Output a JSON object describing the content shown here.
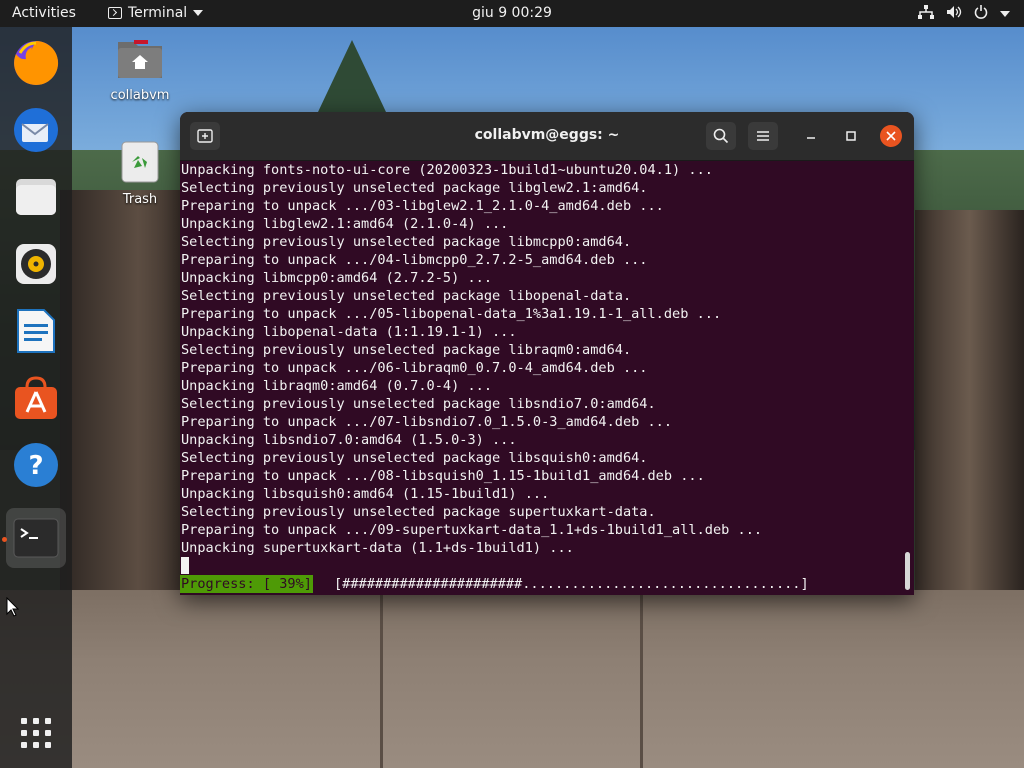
{
  "topbar": {
    "activities": "Activities",
    "app_name": "Terminal",
    "clock": "giu 9  00:29"
  },
  "dock": {
    "items": [
      "firefox",
      "thunderbird",
      "files",
      "rhythmbox",
      "writer",
      "software",
      "help",
      "terminal"
    ]
  },
  "desktop": {
    "icons": [
      {
        "label": "collabvm",
        "icon": "home-folder-icon"
      },
      {
        "label": "Trash",
        "icon": "trash-icon"
      }
    ]
  },
  "window": {
    "title": "collabvm@eggs: ~",
    "terminal_lines": [
      "Unpacking fonts-noto-ui-core (20200323-1build1~ubuntu20.04.1) ...",
      "Selecting previously unselected package libglew2.1:amd64.",
      "Preparing to unpack .../03-libglew2.1_2.1.0-4_amd64.deb ...",
      "Unpacking libglew2.1:amd64 (2.1.0-4) ...",
      "Selecting previously unselected package libmcpp0:amd64.",
      "Preparing to unpack .../04-libmcpp0_2.7.2-5_amd64.deb ...",
      "Unpacking libmcpp0:amd64 (2.7.2-5) ...",
      "Selecting previously unselected package libopenal-data.",
      "Preparing to unpack .../05-libopenal-data_1%3a1.19.1-1_all.deb ...",
      "Unpacking libopenal-data (1:1.19.1-1) ...",
      "Selecting previously unselected package libraqm0:amd64.",
      "Preparing to unpack .../06-libraqm0_0.7.0-4_amd64.deb ...",
      "Unpacking libraqm0:amd64 (0.7.0-4) ...",
      "Selecting previously unselected package libsndio7.0:amd64.",
      "Preparing to unpack .../07-libsndio7.0_1.5.0-3_amd64.deb ...",
      "Unpacking libsndio7.0:amd64 (1.5.0-3) ...",
      "Selecting previously unselected package libsquish0:amd64.",
      "Preparing to unpack .../08-libsquish0_1.15-1build1_amd64.deb ...",
      "Unpacking libsquish0:amd64 (1.15-1build1) ...",
      "Selecting previously unselected package supertuxkart-data.",
      "Preparing to unpack .../09-supertuxkart-data_1.1+ds-1build1_all.deb ...",
      "Unpacking supertuxkart-data (1.1+ds-1build1) ..."
    ],
    "progress_label": "Progress: [ 39%]",
    "progress_bar": "[######################..................................]",
    "progress_percent": 39
  },
  "colors": {
    "terminal_bg": "#300a24",
    "progress_green": "#4e9a06",
    "close_button": "#e95420"
  }
}
